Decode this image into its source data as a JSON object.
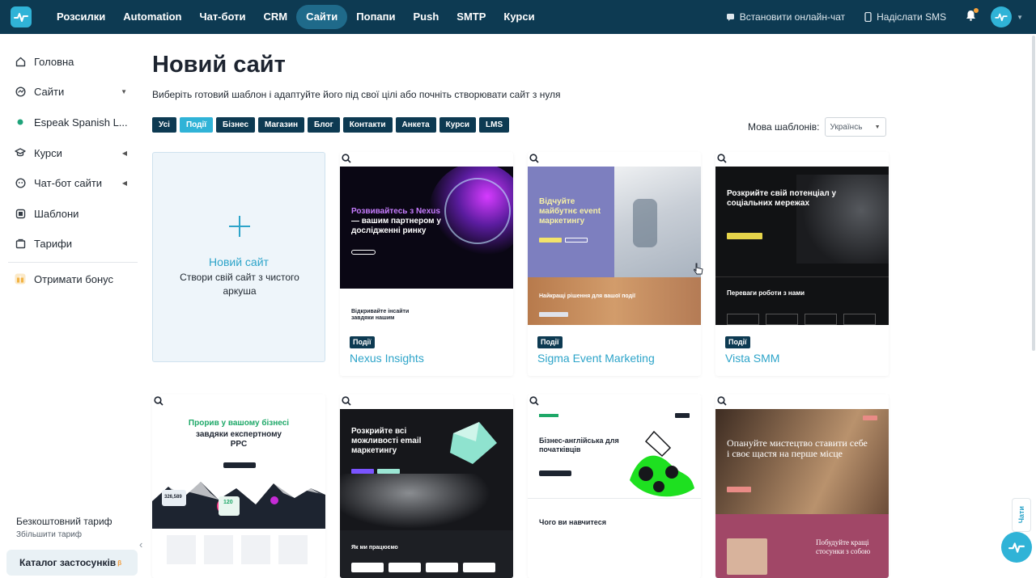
{
  "nav": {
    "items": [
      {
        "label": "Розсилки"
      },
      {
        "label": "Automation"
      },
      {
        "label": "Чат-боти"
      },
      {
        "label": "CRM"
      },
      {
        "label": "Сайти",
        "active": true
      },
      {
        "label": "Попапи"
      },
      {
        "label": "Push"
      },
      {
        "label": "SMTP"
      },
      {
        "label": "Курси"
      }
    ],
    "install_chat": "Встановити онлайн-чат",
    "send_sms": "Надіслати SMS"
  },
  "sidebar": {
    "items": [
      {
        "label": "Головна",
        "icon": "home-icon"
      },
      {
        "label": "Сайти",
        "icon": "globe-icon"
      },
      {
        "label": "Espeak Spanish L...",
        "icon": "status-dot-icon"
      },
      {
        "label": "Курси",
        "icon": "graduation-cap-icon"
      },
      {
        "label": "Чат-бот сайти",
        "icon": "chat-bot-icon"
      },
      {
        "label": "Шаблони",
        "icon": "template-icon"
      },
      {
        "label": "Тарифи",
        "icon": "pricing-icon"
      },
      {
        "label": "Отримати бонус",
        "icon": "gift-icon"
      }
    ],
    "plan": "Безкоштовний тариф",
    "plan_upgrade": "Збільшити тариф",
    "catalog": "Каталог застосунків",
    "catalog_badge": "β"
  },
  "main": {
    "title": "Новий сайт",
    "subtitle": "Виберіть готовий шаблон і адаптуйте його під свої цілі або почніть створювати сайт з нуля",
    "filters": [
      {
        "label": "Усі"
      },
      {
        "label": "Події",
        "active": true
      },
      {
        "label": "Бізнес"
      },
      {
        "label": "Магазин"
      },
      {
        "label": "Блог"
      },
      {
        "label": "Контакти"
      },
      {
        "label": "Анкета"
      },
      {
        "label": "Курси"
      },
      {
        "label": "LMS"
      }
    ],
    "lang_label": "Мова шаблонів:",
    "lang_value": "Українсь",
    "new_site": {
      "title": "Новий сайт",
      "subtitle": "Створи свій сайт з чистого аркуша"
    },
    "templates": [
      {
        "category": "Події",
        "name": "Nexus Insights",
        "preview_heading_accent": "Розвивайтесь з Nexus",
        "preview_heading": "— вашим партнером у дослідженні ринку",
        "preview_section": "Відкривайте інсайти завдяки нашим"
      },
      {
        "category": "Події",
        "name": "Sigma Event Marketing",
        "preview_heading": "Відчуйте майбутнє event маркетингу",
        "preview_section": "Найкращі рішення для вашої події"
      },
      {
        "category": "Події",
        "name": "Vista SMM",
        "preview_heading": "Розкрийте свій потенціал у соціальних мережах",
        "preview_section": "Переваги роботи з нами"
      }
    ],
    "templates_row2": [
      {
        "preview_heading_accent": "Прорив у вашому бізнесі",
        "preview_heading": "завдяки експертному PPC",
        "stat_1": "326,589",
        "stat_2": "120"
      },
      {
        "preview_heading": "Розкрийте всі можливості email маркетингу",
        "preview_section": "Як ми працюємо"
      },
      {
        "preview_heading": "Бізнес-англійська для початківців",
        "preview_section": "Чого ви навчитеся"
      },
      {
        "preview_heading": "Опануйте мистецтво ставити себе і своє щастя на перше місце",
        "preview_section": "Побудуйте кращі стосунки з собою"
      }
    ]
  },
  "chat_tab": "Чати",
  "colors": {
    "topbar": "#0d3a52",
    "accent": "#30b3d7",
    "link": "#2da4c9",
    "chip": "#0d3a52"
  }
}
